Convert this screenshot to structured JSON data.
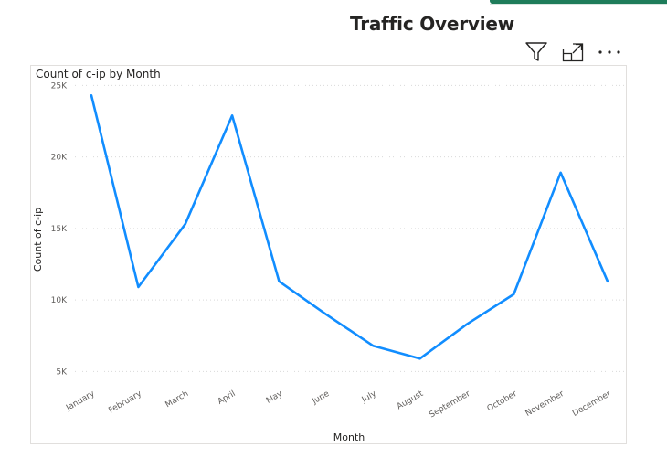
{
  "page": {
    "title": "Traffic Overview"
  },
  "visual_header": {
    "icons": [
      "filter-icon",
      "focus-mode-icon",
      "more-options-icon"
    ]
  },
  "colors": {
    "series": "#118dff",
    "gridline": "#d9d9d9",
    "accent_strip": "#1e7c5a"
  },
  "chart_data": {
    "type": "line",
    "title": "Count of c-ip by Month",
    "xlabel": "Month",
    "ylabel": "Count of c-ip",
    "categories": [
      "January",
      "February",
      "March",
      "April",
      "May",
      "June",
      "July",
      "August",
      "September",
      "October",
      "November",
      "December"
    ],
    "series": [
      {
        "values": [
          24300,
          10900,
          15300,
          22900,
          11300,
          9000,
          6800,
          5900,
          8300,
          10400,
          18900,
          11300
        ]
      }
    ],
    "yticks": [
      5000,
      10000,
      15000,
      20000,
      25000
    ],
    "ytick_labels": [
      "5K",
      "10K",
      "15K",
      "20K",
      "25K"
    ],
    "ylim": [
      4000,
      25600
    ],
    "grid": true,
    "legend": "none"
  }
}
